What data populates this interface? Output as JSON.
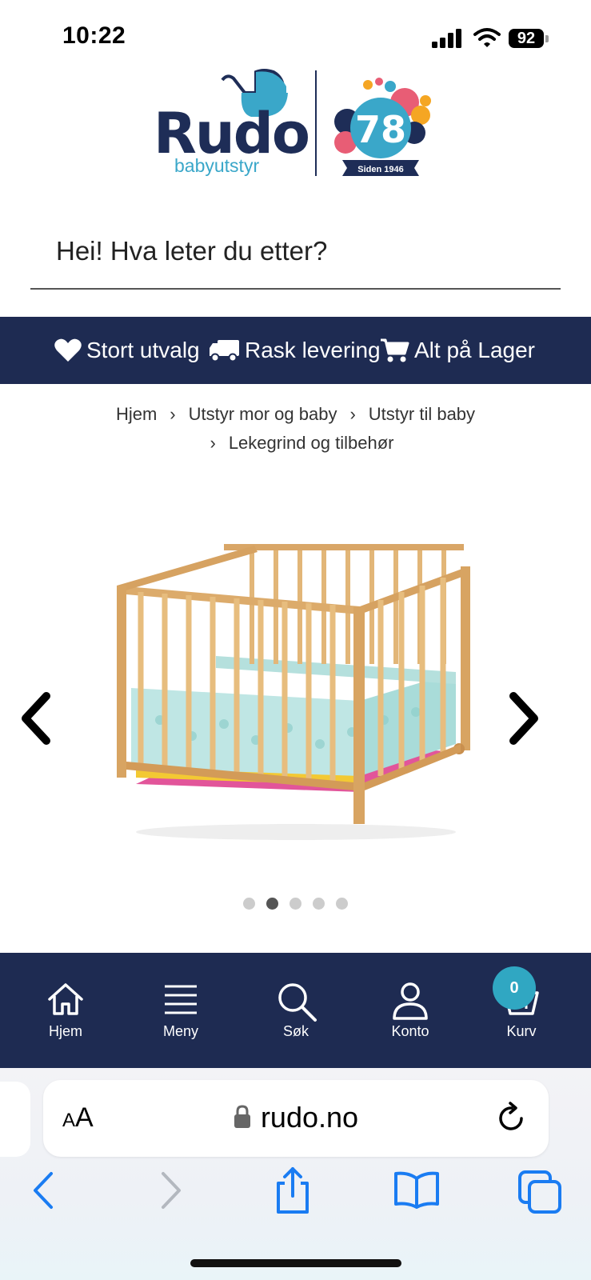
{
  "status_bar": {
    "time": "10:22",
    "battery": "92"
  },
  "logo": {
    "brand": "Rudo",
    "subtitle": "babyutstyr",
    "anniversary_number": "78",
    "anniversary_text": "Siden 1946"
  },
  "search": {
    "placeholder": "Hei! Hva leter du etter?"
  },
  "usp": [
    {
      "label": "Stort utvalg",
      "icon": "heart-icon"
    },
    {
      "label": "Rask levering",
      "icon": "truck-icon"
    },
    {
      "label": "Alt på Lager",
      "icon": "cart-icon"
    }
  ],
  "breadcrumb": {
    "items": [
      "Hjem",
      "Utstyr mor og baby",
      "Utstyr til baby",
      "Lekegrind og tilbehør"
    ]
  },
  "carousel": {
    "total_slides": 5,
    "active_slide": 2
  },
  "bottom_nav": {
    "items": [
      {
        "label": "Hjem",
        "icon": "home-icon"
      },
      {
        "label": "Meny",
        "icon": "menu-icon"
      },
      {
        "label": "Søk",
        "icon": "search-icon"
      },
      {
        "label": "Konto",
        "icon": "user-icon"
      },
      {
        "label": "Kurv",
        "icon": "basket-icon"
      }
    ],
    "cart_count": "0"
  },
  "browser": {
    "text_size_label_small": "A",
    "text_size_label_large": "A",
    "url": "rudo.no"
  },
  "colors": {
    "navy": "#1e2b52",
    "accent": "#30a7c2"
  }
}
